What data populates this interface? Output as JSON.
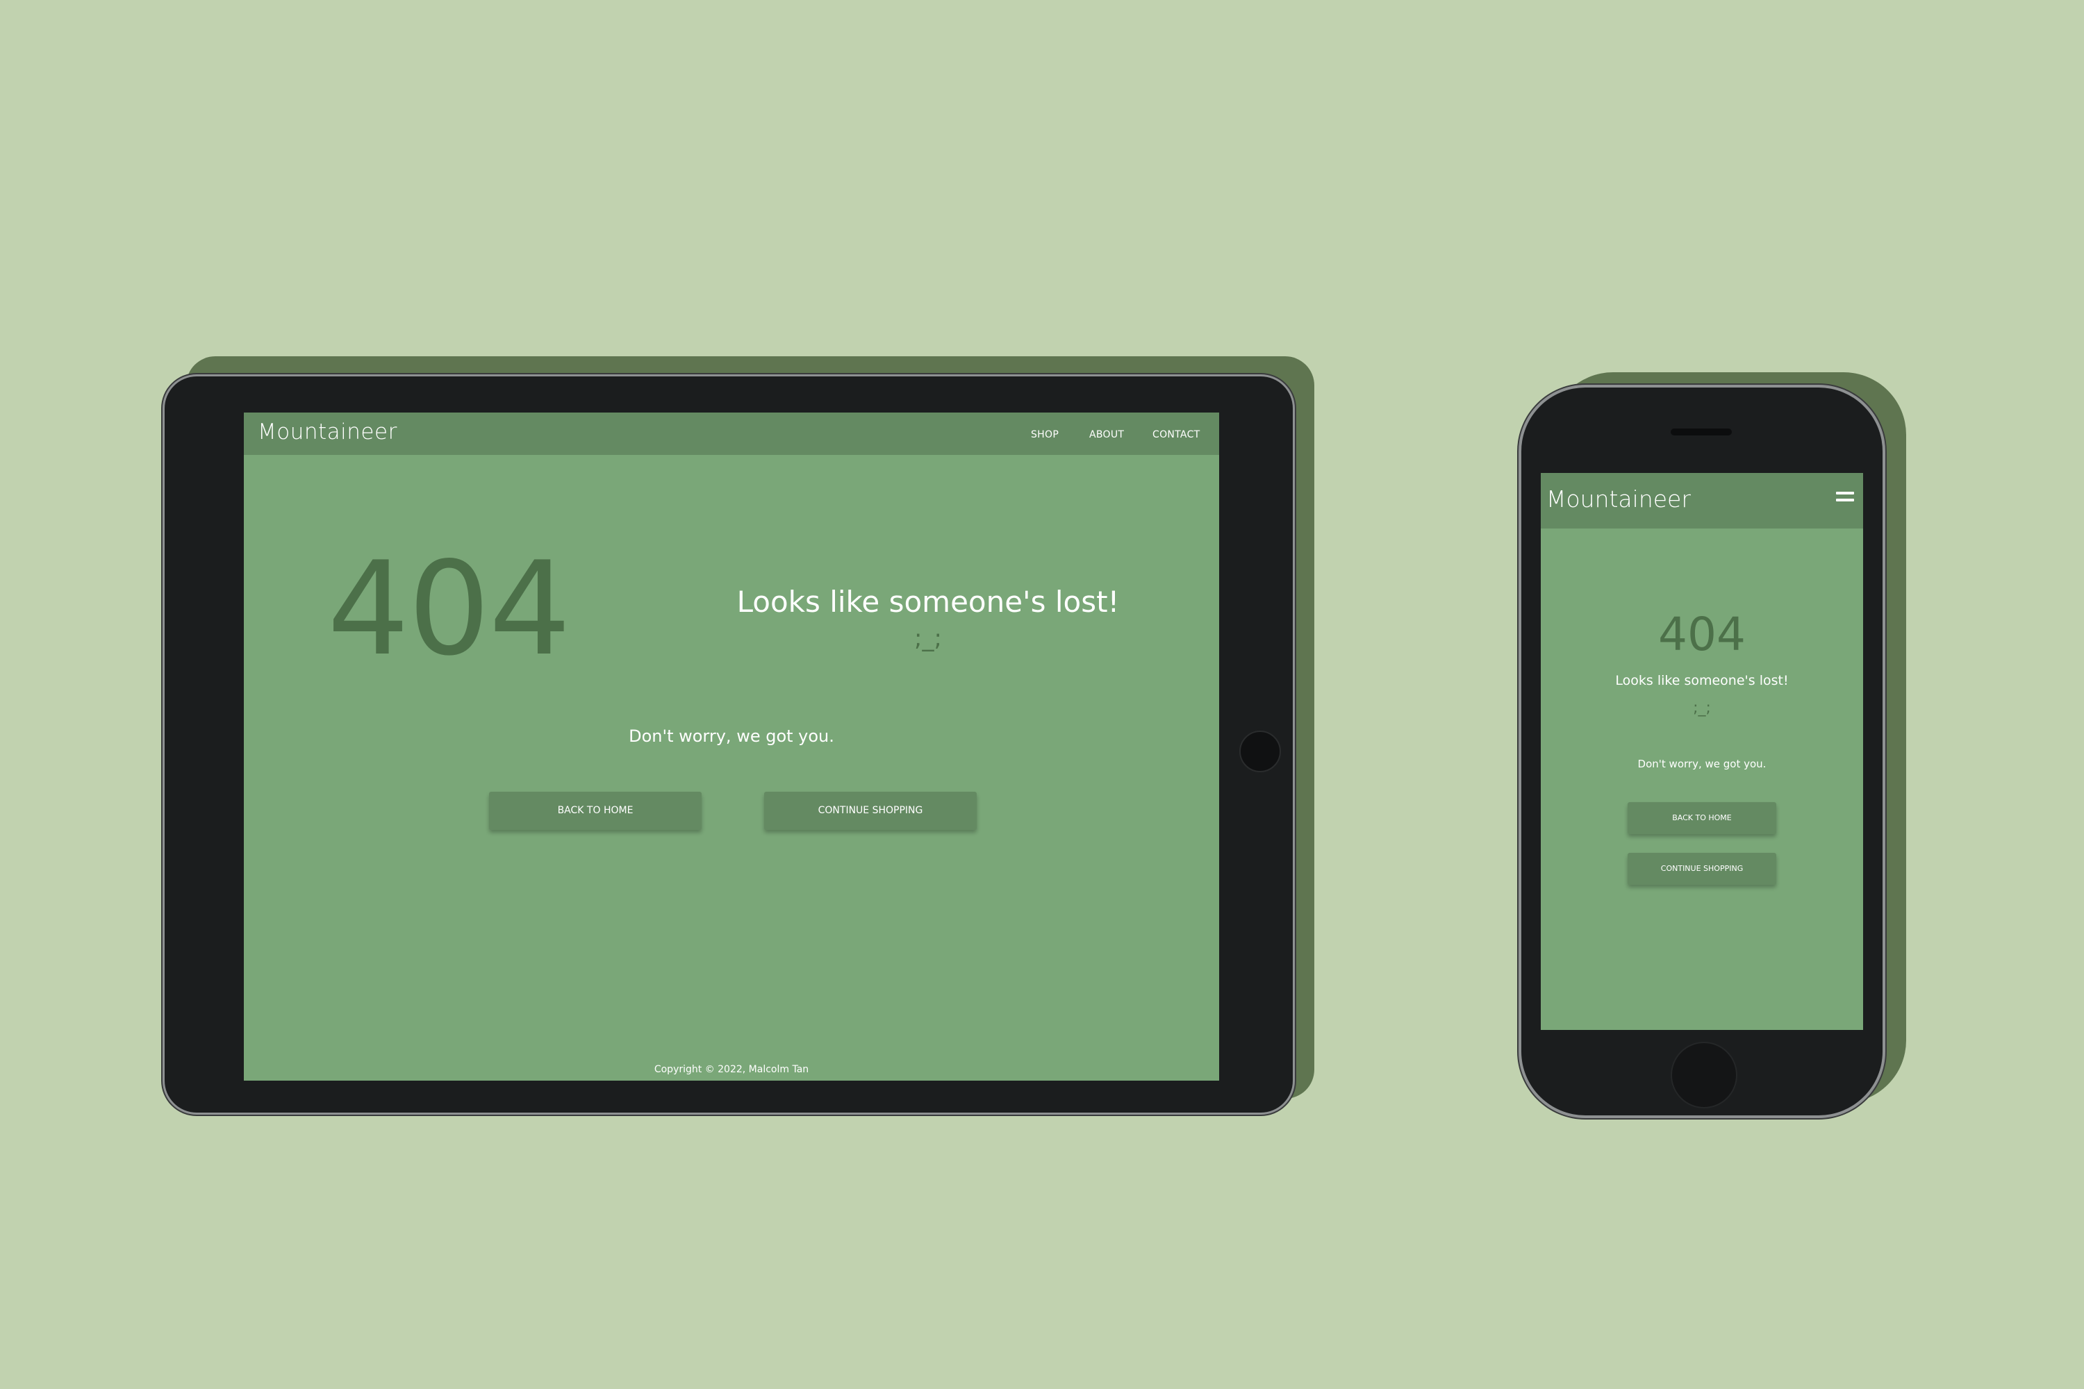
{
  "colors": {
    "background": "#c1d2af",
    "page": "#7aa778",
    "nav": "#648a62",
    "accent_text": "#4c7049",
    "device_body": "#1b1d1e"
  },
  "tablet": {
    "brand": "Mountaineer",
    "nav": {
      "shop": "SHOP",
      "about": "ABOUT",
      "contact": "CONTACT"
    },
    "error_code": "404",
    "headline": "Looks like someone's lost!",
    "emoticon": ";_;",
    "subtext": "Don't worry, we got you.",
    "buttons": {
      "home": "BACK TO HOME",
      "shop": "CONTINUE SHOPPING"
    },
    "footer": "Copyright © 2022, Malcolm Tan"
  },
  "phone": {
    "brand": "Mountaineer",
    "menu_icon": "hamburger-menu-icon",
    "error_code": "404",
    "headline": "Looks like someone's lost!",
    "emoticon": ";_;",
    "subtext": "Don't worry, we got you.",
    "buttons": {
      "home": "BACK TO HOME",
      "shop": "CONTINUE SHOPPING"
    }
  }
}
